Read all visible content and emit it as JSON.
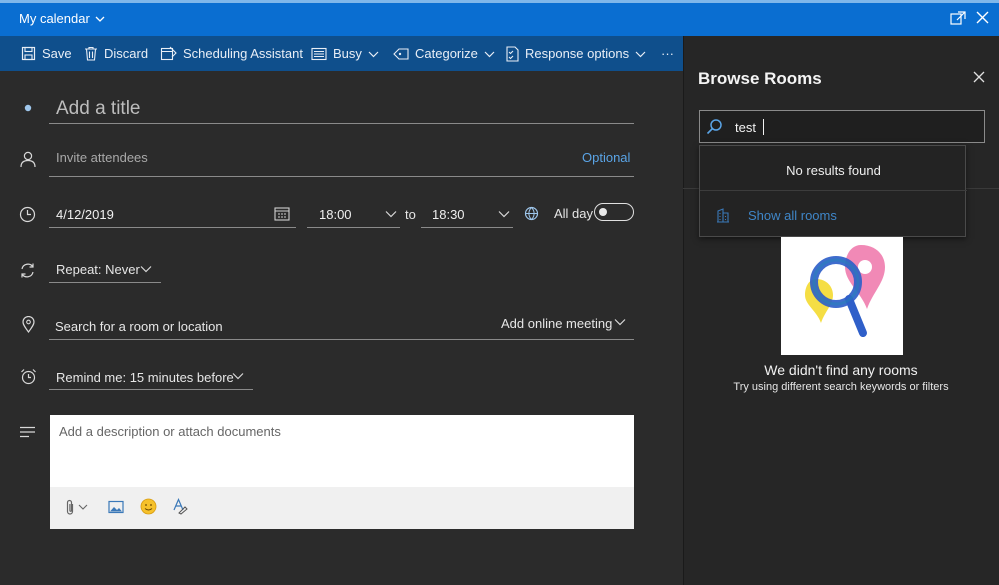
{
  "titlebar": {
    "calendar_name": "My calendar"
  },
  "toolbar": {
    "save": "Save",
    "discard": "Discard",
    "scheduling": "Scheduling Assistant",
    "busy": "Busy",
    "categorize": "Categorize",
    "response": "Response options",
    "more": "···"
  },
  "event": {
    "title_placeholder": "Add a title",
    "attendees_placeholder": "Invite attendees",
    "optional": "Optional",
    "date": "4/12/2019",
    "start_time": "18:00",
    "to": "to",
    "end_time": "18:30",
    "all_day": "All day",
    "all_day_on": false,
    "repeat": "Repeat:",
    "repeat_value": "Never",
    "location_placeholder": "Search for a room or location",
    "online_meeting": "Add online meeting",
    "remind": "Remind me:",
    "remind_value": "15 minutes before",
    "description_placeholder": "Add a description or attach documents"
  },
  "panel": {
    "title": "Browse Rooms",
    "search_value": "test",
    "no_results": "No results found",
    "show_all": "Show all rooms",
    "empty_title": "We didn't find any rooms",
    "empty_sub": "Try using different search keywords or filters"
  },
  "colors": {
    "accent": "#0a6ed1",
    "toolbar": "#0f4f8c",
    "background": "#2b2b2b",
    "link": "#4a9be0"
  }
}
